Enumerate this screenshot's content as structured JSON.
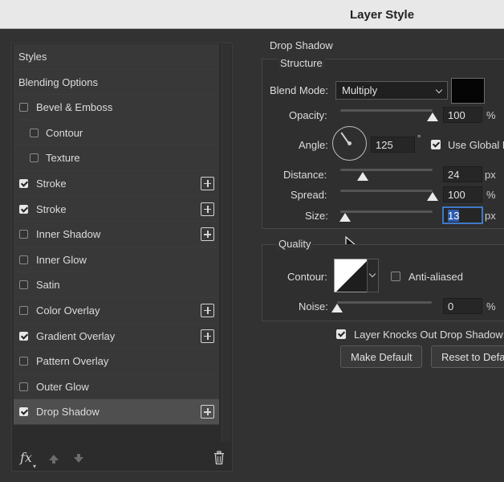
{
  "window": {
    "title": "Layer Style"
  },
  "styles_list": {
    "header_items": [
      "Styles",
      "Blending Options"
    ],
    "items": [
      {
        "label": "Bevel & Emboss",
        "checked": false,
        "indent": false,
        "has_add": false
      },
      {
        "label": "Contour",
        "checked": false,
        "indent": true,
        "has_add": false
      },
      {
        "label": "Texture",
        "checked": false,
        "indent": true,
        "has_add": false
      },
      {
        "label": "Stroke",
        "checked": true,
        "indent": false,
        "has_add": true
      },
      {
        "label": "Stroke",
        "checked": true,
        "indent": false,
        "has_add": true
      },
      {
        "label": "Inner Shadow",
        "checked": false,
        "indent": false,
        "has_add": true
      },
      {
        "label": "Inner Glow",
        "checked": false,
        "indent": false,
        "has_add": false
      },
      {
        "label": "Satin",
        "checked": false,
        "indent": false,
        "has_add": false
      },
      {
        "label": "Color Overlay",
        "checked": false,
        "indent": false,
        "has_add": true
      },
      {
        "label": "Gradient Overlay",
        "checked": true,
        "indent": false,
        "has_add": true
      },
      {
        "label": "Pattern Overlay",
        "checked": false,
        "indent": false,
        "has_add": false
      },
      {
        "label": "Outer Glow",
        "checked": false,
        "indent": false,
        "has_add": false
      },
      {
        "label": "Drop Shadow",
        "checked": true,
        "indent": false,
        "has_add": true,
        "selected": true
      }
    ],
    "footer": {
      "fx_label": "fx",
      "icons": [
        "move-up-icon",
        "move-down-icon",
        "trash-icon"
      ]
    }
  },
  "drop_shadow": {
    "section_title": "Drop Shadow",
    "structure": {
      "title": "Structure",
      "blend_mode_label": "Blend Mode:",
      "blend_mode_value": "Multiply",
      "shadow_color": "#050505",
      "opacity_label": "Opacity:",
      "opacity_value": "100",
      "opacity_level": 1.0,
      "percent_unit": "%",
      "angle_label": "Angle:",
      "angle_value": "125",
      "degree_unit": "°",
      "use_global_light_label": "Use Global L",
      "use_global_light_checked": true,
      "distance_label": "Distance:",
      "distance_value": "24",
      "distance_level": 0.24,
      "spread_label": "Spread:",
      "spread_value": "100",
      "spread_level": 1.0,
      "size_label": "Size:",
      "size_value": "13",
      "size_level": 0.05,
      "px_unit": "px"
    },
    "quality": {
      "title": "Quality",
      "contour_label": "Contour:",
      "anti_aliased_label": "Anti-aliased",
      "anti_aliased_checked": false,
      "noise_label": "Noise:",
      "noise_value": "0",
      "noise_level": 0.0,
      "percent_unit": "%"
    },
    "layer_knocks_label": "Layer Knocks Out Drop Shadow",
    "layer_knocks_checked": true,
    "make_default_label": "Make Default",
    "reset_default_label": "Reset to Defa"
  }
}
